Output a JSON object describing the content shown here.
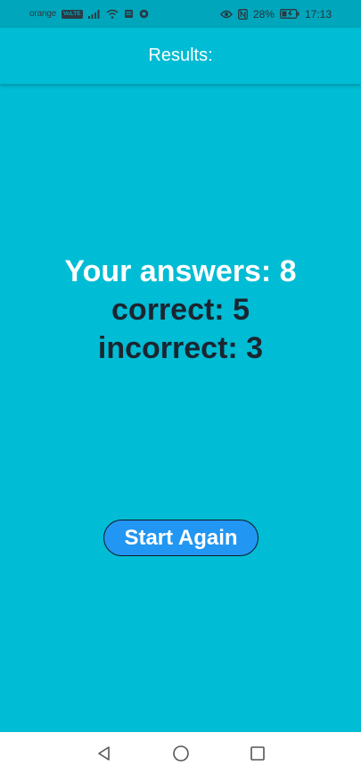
{
  "status_bar": {
    "carrier": "orange",
    "volte": "VoLTE",
    "battery_percent": "28%",
    "time": "17:13",
    "icons": [
      "signal-icon",
      "wifi-icon",
      "notification-icon",
      "vpn-icon",
      "eye-icon",
      "nfc-icon",
      "battery-icon"
    ]
  },
  "app_bar": {
    "title": "Results:"
  },
  "results": {
    "total_line": "Your answers: 8",
    "correct_line": "correct: 5",
    "incorrect_line": "incorrect: 3"
  },
  "actions": {
    "start_again_label": "Start Again"
  },
  "nav_bar": {
    "icons": [
      "back-icon",
      "home-icon",
      "recents-icon"
    ]
  },
  "colors": {
    "background": "#00bcd4",
    "status_bar": "#00a6bb",
    "button": "#2196f3",
    "dark_text": "#1b2530"
  }
}
